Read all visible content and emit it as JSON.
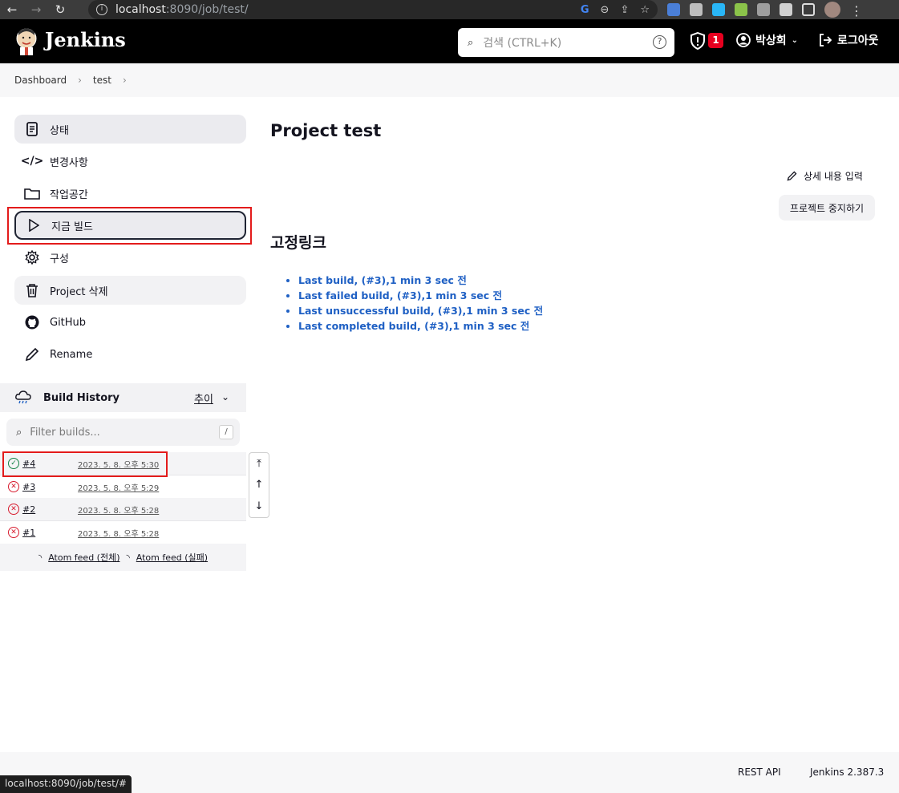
{
  "browser": {
    "url_host": "localhost",
    "url_rest": ":8090/job/test/",
    "status_url": "localhost:8090/job/test/#"
  },
  "header": {
    "brand": "Jenkins",
    "search_placeholder": "검색 (CTRL+K)",
    "security_count": "1",
    "user_name": "박상희",
    "logout_label": "로그아웃"
  },
  "breadcrumb": {
    "items": [
      "Dashboard",
      "test"
    ]
  },
  "sidebar": {
    "items": [
      {
        "label": "상태",
        "icon": "document-icon"
      },
      {
        "label": "변경사항",
        "icon": "code-icon"
      },
      {
        "label": "작업공간",
        "icon": "folder-icon"
      },
      {
        "label": "지금 빌드",
        "icon": "play-icon"
      },
      {
        "label": "구성",
        "icon": "gear-icon"
      },
      {
        "label": "Project 삭제",
        "icon": "trash-icon"
      },
      {
        "label": "GitHub",
        "icon": "github-icon"
      },
      {
        "label": "Rename",
        "icon": "pencil-icon"
      }
    ]
  },
  "build_history": {
    "title": "Build History",
    "trend_label": "추이",
    "filter_placeholder": "Filter builds...",
    "filter_shortcut": "/",
    "builds": [
      {
        "number": "#4",
        "date": "2023. 5. 8. 오후 5:30",
        "status": "success"
      },
      {
        "number": "#3",
        "date": "2023. 5. 8. 오후 5:29",
        "status": "failed"
      },
      {
        "number": "#2",
        "date": "2023. 5. 8. 오후 5:28",
        "status": "failed"
      },
      {
        "number": "#1",
        "date": "2023. 5. 8. 오후 5:28",
        "status": "failed"
      }
    ],
    "feed_all": "Atom feed (전체)",
    "feed_failed": "Atom feed (실패)"
  },
  "main": {
    "title": "Project test",
    "edit_description": "상세 내용 입력",
    "disable_project": "프로젝트 중지하기",
    "permalinks_title": "고정링크",
    "permalinks": [
      "Last build, (#3),1 min 3 sec 전",
      "Last failed build, (#3),1 min 3 sec 전",
      "Last unsuccessful build, (#3),1 min 3 sec 전",
      "Last completed build, (#3),1 min 3 sec 전"
    ]
  },
  "footer": {
    "rest_api": "REST API",
    "version": "Jenkins 2.387.3"
  },
  "colors": {
    "header_bg": "#000000",
    "link_blue": "#1f60c4",
    "success_green": "#138347",
    "failure_red": "#d71b2e",
    "highlight_red": "#e31b1b"
  }
}
